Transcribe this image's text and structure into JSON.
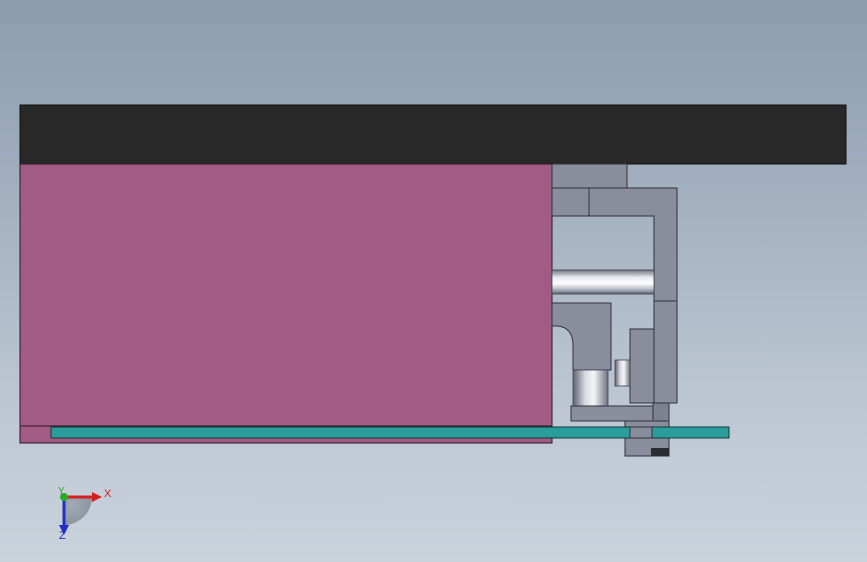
{
  "view": {
    "background_top": "#8c9cae",
    "background_bottom": "#cad2dc"
  },
  "parts": {
    "top_plate_color": "#282828",
    "main_block_color": "#a15b84",
    "bar_color": "#2b9c9c",
    "bracket_color": "#8a8d9c",
    "bracket_edge_color": "#30323a"
  },
  "triad": {
    "x_label": "X",
    "y_label": "Y",
    "z_label": "Z",
    "x_color": "#d42020",
    "y_color": "#22b022",
    "z_color": "#2030c0"
  }
}
